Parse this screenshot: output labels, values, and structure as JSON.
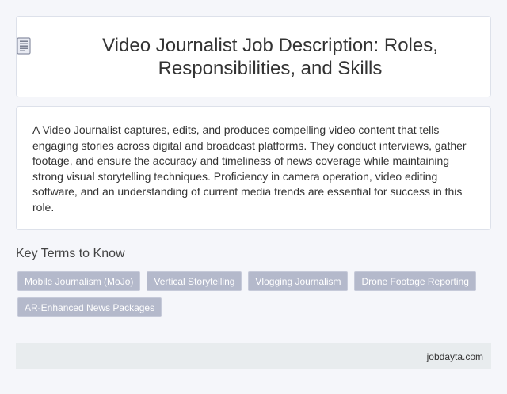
{
  "header": {
    "title": "Video Journalist Job Description: Roles, Responsibilities, and Skills",
    "icon": "document-icon"
  },
  "description": {
    "text": "A Video Journalist captures, edits, and produces compelling video content that tells engaging stories across digital and broadcast platforms. They conduct interviews, gather footage, and ensure the accuracy and timeliness of news coverage while maintaining strong visual storytelling techniques. Proficiency in camera operation, video editing software, and an understanding of current media trends are essential for success in this role."
  },
  "key_terms": {
    "heading": "Key Terms to Know",
    "tags": [
      "Mobile Journalism (MoJo)",
      "Vertical Storytelling",
      "Vlogging Journalism",
      "Drone Footage Reporting",
      "AR-Enhanced News Packages"
    ]
  },
  "footer": {
    "site": "jobdayta.com"
  },
  "colors": {
    "background": "#f5f6fa",
    "card": "#ffffff",
    "tag_bg": "#b4b9cb",
    "footer_bg": "#e8ecee"
  }
}
